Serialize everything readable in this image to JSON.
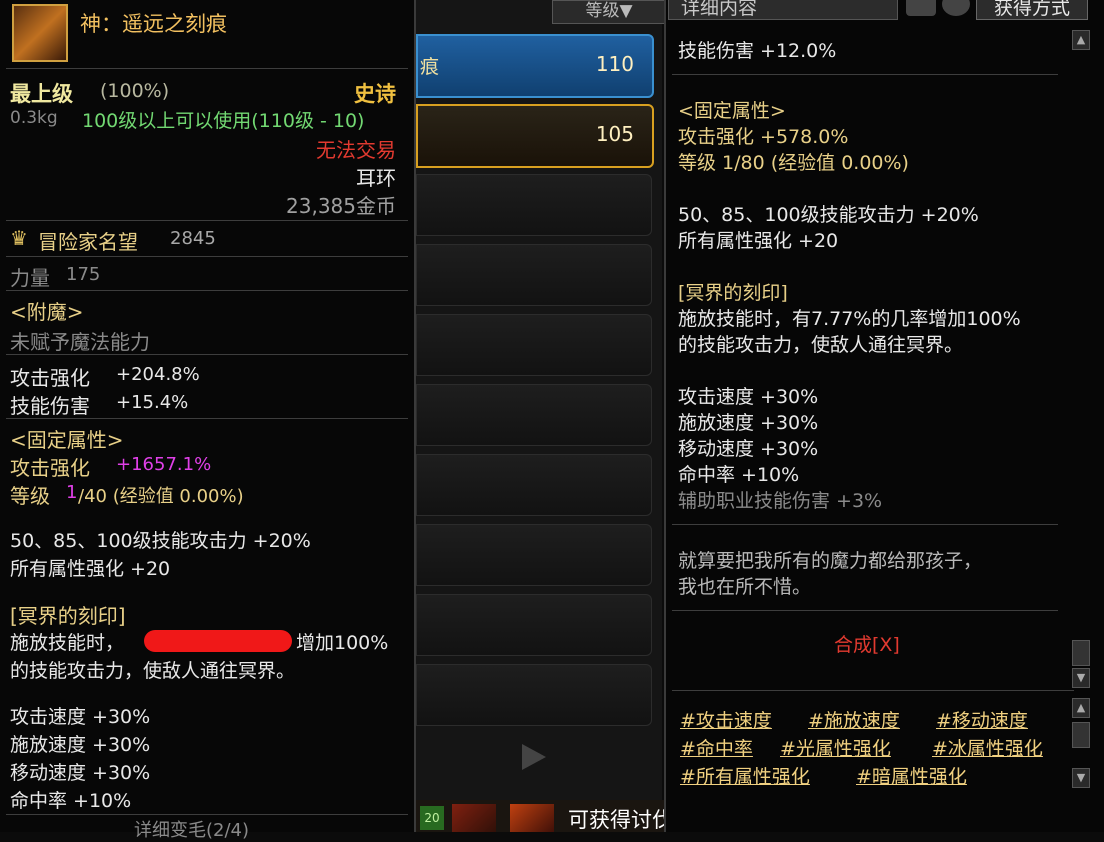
{
  "item": {
    "name": "神：遥远之刻痕",
    "grade": "最上级",
    "grade_pct": "(100%)",
    "rarity": "史诗",
    "weight": "0.3kg",
    "level_req": "100级以上可以使用(110级 - 10)",
    "trade": "无法交易",
    "slot_type": "耳环",
    "price": "23,385金币",
    "fame_label": "冒险家名望",
    "fame_value": "2845",
    "stat_label": "力量",
    "stat_value": "175",
    "enchant_header": "<附魔>",
    "enchant_text": "未赋予魔法能力",
    "attack_label": "攻击强化",
    "attack_value": "+204.8%",
    "skill_dmg_label": "技能伤害",
    "skill_dmg_value": "+15.4%",
    "fixed_header": "<固定属性>",
    "fixed_attack_label": "攻击强化",
    "fixed_attack_value": "+1657.1%",
    "level_line_a": "等级",
    "level_line_b": "1",
    "level_line_c": "/40 (经验值 0.00%)",
    "skill_atk_line": "50、85、100级技能攻击力 +20%",
    "all_attr_line": "所有属性强化 +20",
    "underworld_header": "[冥界的刻印]",
    "underworld_line1_a": "施放技能时，",
    "underworld_line1_b": "增加100%",
    "underworld_line2": "的技能攻击力，使敌人通往冥界。",
    "speed_lines": [
      "攻击速度 +30%",
      "施放速度 +30%",
      "移动速度 +30%",
      "命中率 +10%"
    ],
    "cut_line": "详细变毛(2/4)"
  },
  "middle": {
    "header": "等级▼",
    "slot1_text": "痕",
    "slot1_level": "110",
    "slot2_level": "105"
  },
  "right": {
    "header_tab": "详细内容",
    "header_btn": "获得方式",
    "skill_dmg": "技能伤害 +12.0%",
    "fixed_header": "<固定属性>",
    "attack": "攻击强化 +578.0%",
    "level": "等级 1/80 (经验值 0.00%)",
    "skill_atk": "50、85、100级技能攻击力 +20%",
    "all_attr": "所有属性强化 +20",
    "underworld_header": "[冥界的刻印]",
    "underworld_line1": "施放技能时，有7.77%的几率增加100%",
    "underworld_line2": "的技能攻击力，使敌人通往冥界。",
    "speed_lines": [
      "攻击速度 +30%",
      "施放速度 +30%",
      "移动速度 +30%",
      "命中率 +10%"
    ],
    "support_line": "辅助职业技能伤害 +3%",
    "flavor1": "就算要把我所有的魔力都给那孩子，",
    "flavor2": "我也在所不惜。",
    "synth": "合成[X]",
    "tags": [
      [
        "#攻击速度",
        "#施放速度",
        "#移动速度"
      ],
      [
        "#命中率",
        "#光属性强化",
        "#冰属性强化"
      ],
      [
        "#所有属性强化",
        "#暗属性强化"
      ]
    ]
  },
  "bottom": {
    "reward_text": "可获得讨伐战奖励!",
    "badge": "20"
  },
  "colors": {
    "gold": "#e8d088",
    "red": "#e23a30",
    "pink": "#e040e8",
    "green": "#72d872"
  }
}
